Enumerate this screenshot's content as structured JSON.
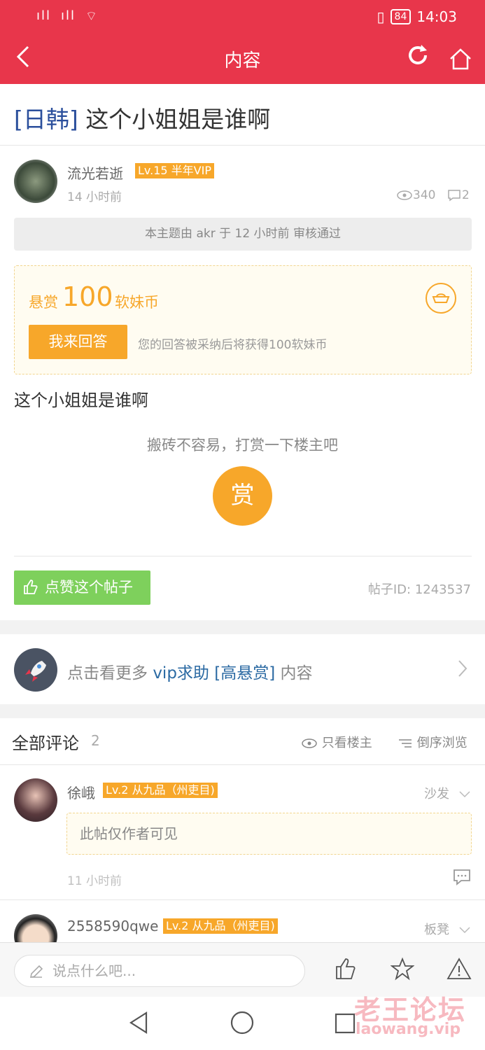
{
  "status_bar": {
    "signal_1": "ıll",
    "signal_2": "ıll",
    "wifi": "⌔",
    "vibrate": "▯",
    "battery": "84",
    "time": "14:03"
  },
  "nav": {
    "title": "内容",
    "back_icon": "chevron-left",
    "refresh_icon": "refresh",
    "home_icon": "home"
  },
  "post": {
    "tag": "[日韩]",
    "title": " 这个小姐姐是谁啊",
    "author": {
      "name": "流光若逝",
      "badge": "Lv.15 半年VIP",
      "time": "14 小时前"
    },
    "views": "340",
    "replies": "2",
    "audit_note": "本主题由 akr 于 12 小时前 审核通过",
    "reward": {
      "label": "悬赏",
      "amount": "100",
      "unit": "软妹币",
      "button": "我来回答",
      "hint": "您的回答被采纳后将获得100软妹币"
    },
    "body": "这个小姐姐是谁啊",
    "tip": {
      "text": "搬砖不容易，打赏一下楼主吧",
      "button": "赏"
    },
    "like_button": "点赞这个帖子",
    "post_id": "帖子ID: 1243537"
  },
  "more_link": {
    "prefix": "点击看更多 ",
    "highlight": "vip求助 [高悬赏]",
    "suffix": " 内容"
  },
  "comments": {
    "title": "全部评论",
    "count": "2",
    "only_author": "只看楼主",
    "reverse_order": "倒序浏览",
    "items": [
      {
        "name": "徐峨",
        "badge": "Lv.2 从九品（州吏目)",
        "floor": "沙发",
        "content": "此帖仅作者可见",
        "time": "11 小时前"
      },
      {
        "name": "2558590qwe",
        "badge": "Lv.2 从九品（州吏目)",
        "floor": "板凳"
      }
    ]
  },
  "bottom_bar": {
    "placeholder": "说点什么吧..."
  },
  "watermark": {
    "cn": "老王论坛",
    "en": "laowang.vip"
  },
  "colors": {
    "brand": "#e8364b",
    "accent": "#f7a72a",
    "green": "#7ed05c",
    "link": "#2b6aa3"
  }
}
